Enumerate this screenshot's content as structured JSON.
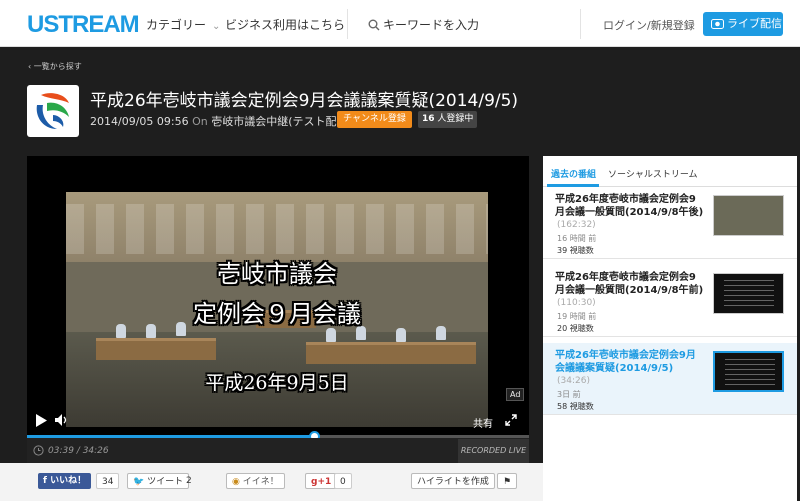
{
  "header": {
    "logo": "USTREAM",
    "nav_category": "カテゴリー",
    "nav_business": "ビジネス利用はこちら",
    "search_placeholder": "キーワードを入力",
    "login": "ログイン/新規登録",
    "live_button": "ライブ配信",
    "accent_color": "#1e9be2"
  },
  "page": {
    "back_link": "一覧から探す",
    "title": "平成26年壱岐市議会定例会9月会議議案質疑(2014/9/5)",
    "datetime": "2014/09/05 09:56",
    "on_label": "On",
    "channel": "壱岐市議会中継(テスト配信)",
    "subscribe_button": "チャンネル登録",
    "subscriber_count": "16",
    "subscriber_suffix": "人登録中"
  },
  "player": {
    "caption_line1": "壱岐市議会",
    "caption_line2": "定例会９月会議",
    "caption_line3": "平成26年9月5日",
    "ad_label": "Ad",
    "share_label": "共有",
    "time": "03:39 / 34:26",
    "recorded_label": "RECORDED LIVE",
    "progress_fraction": 0.106
  },
  "social": {
    "like_label": "いいね！",
    "like_count": "34",
    "tweet_label": "ツイート",
    "tweet_count": "2",
    "mixi_label": "イイネ！",
    "gplus_label": "g+1",
    "gplus_count": "0",
    "highlight_button": "ハイライトを作成"
  },
  "sidebar": {
    "tab_past": "過去の番組",
    "tab_social": "ソーシャルストリーム",
    "items": [
      {
        "title": "平成26年度壱岐市議会定例会9月会議一般質問(2014/9/8午後)",
        "duration": "(162:32)",
        "when": "16 時間 前",
        "views": "39 視聴数"
      },
      {
        "title": "平成26年度壱岐市議会定例会9月会議一般質問(2014/9/8午前)",
        "duration": "(110:30)",
        "when": "19 時間 前",
        "views": "20 視聴数"
      },
      {
        "title": "平成26年壱岐市議会定例会9月会議議案質疑(2014/9/5)",
        "duration": "(34:26)",
        "when": "3日 前",
        "views": "58 視聴数"
      }
    ]
  }
}
